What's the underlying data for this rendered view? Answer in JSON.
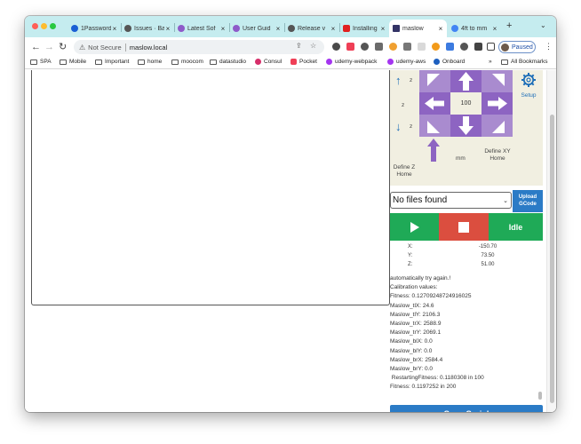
{
  "browser": {
    "tabs": [
      {
        "label": "1Password",
        "icon_color": "#1a5fd4"
      },
      {
        "label": "Issues · Ba",
        "icon_color": "#555555"
      },
      {
        "label": "Latest Sof",
        "icon_color": "#8e5ac9"
      },
      {
        "label": "User Guid",
        "icon_color": "#8e5ac9"
      },
      {
        "label": "Release v",
        "icon_color": "#555555"
      },
      {
        "label": "Installing",
        "icon_color": "#e02020"
      },
      {
        "label": "maslow",
        "icon_color": "#333366"
      },
      {
        "label": "4ft to mm",
        "icon_color": "#4285f4"
      }
    ],
    "active_tab": 6,
    "address": {
      "security_label": "Not Secure",
      "url": "maslow.local"
    },
    "profile_label": "Paused"
  },
  "bookmarks": [
    {
      "label": "SPA",
      "icon": "folder-icon"
    },
    {
      "label": "Mobile",
      "icon": "folder-icon"
    },
    {
      "label": "Important",
      "icon": "folder-icon"
    },
    {
      "label": "home",
      "icon": "folder-icon"
    },
    {
      "label": "moocom",
      "icon": "folder-icon"
    },
    {
      "label": "datastudio",
      "icon": "folder-icon"
    },
    {
      "label": "Consul",
      "icon": "consul-icon"
    },
    {
      "label": "Pocket",
      "icon": "pocket-icon"
    },
    {
      "label": "udemy-webpack",
      "icon": "udemy-icon"
    },
    {
      "label": "udemy-aws",
      "icon": "udemy-icon"
    },
    {
      "label": "Onboard",
      "icon": "onboard-icon"
    },
    {
      "label": "All Bookmarks",
      "icon": "folder-icon"
    }
  ],
  "jog": {
    "z_up_label": "z",
    "z_mid_label": "z",
    "z_down_label": "z",
    "define_z_home": "Define Z Home",
    "step_value": "100",
    "unit": "mm",
    "define_xy_home": "Define XY Home",
    "setup_label": "Setup"
  },
  "file": {
    "selected": "No files found",
    "upload_label": "Upload GCode"
  },
  "controls": {
    "status": "Idle"
  },
  "position": {
    "x_label": "X:",
    "x_value": "-150.70",
    "y_label": "Y:",
    "y_value": "73.50",
    "z_label": "Z:",
    "z_value": "51.00"
  },
  "log": [
    "automatically try again.!",
    "Calibration values:",
    "Fitness: 0.12709248724916025",
    "Maslow_tlX: 24.6",
    "Maslow_tlY: 2106.3",
    "Maslow_trX: 2588.9",
    "Maslow_trY: 2069.1",
    "Maslow_blX: 0.0",
    "Maslow_blY: 0.0",
    "Maslow_brX: 2584.4",
    "Maslow_brY: 0.0",
    " RestartingFitness: 0.1180308 in 100",
    "Fitness: 0.1197252 in 200"
  ],
  "save_serial_label": "Save Serial",
  "colors": {
    "tab_strip": "#c5ecef",
    "jog_light": "#a98bcf",
    "jog_dark": "#8d64c2",
    "green": "#1faa57",
    "red": "#db4e3f",
    "blue": "#2b7bc6"
  }
}
